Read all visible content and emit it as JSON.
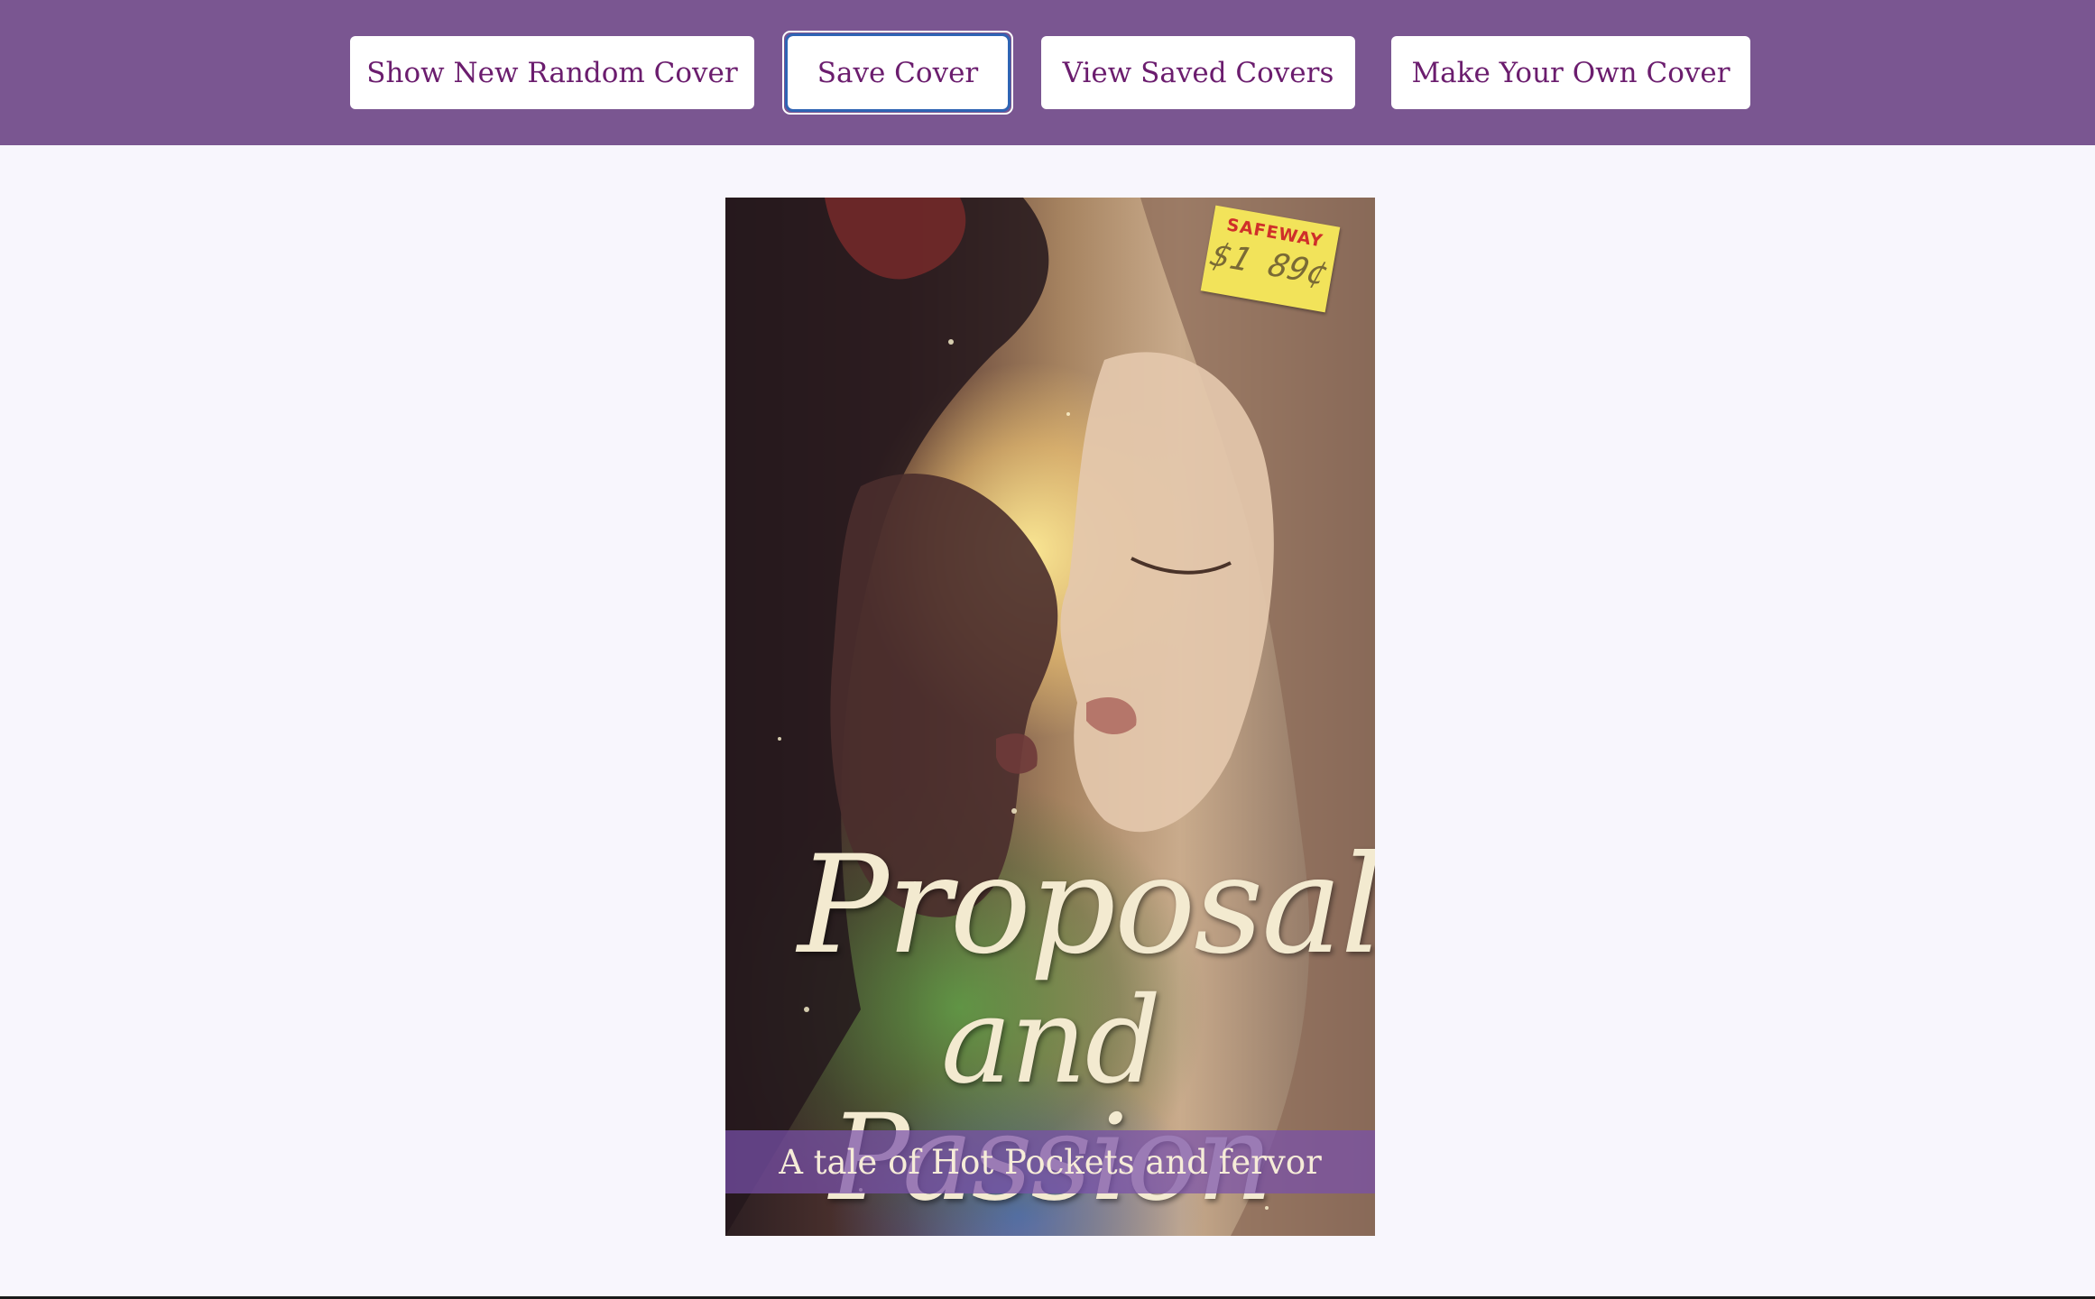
{
  "header": {
    "buttons": {
      "random": "Show New Random Cover",
      "save": "Save Cover",
      "view": "View Saved Covers",
      "make": "Make Your Own Cover"
    }
  },
  "cover": {
    "title_line1": "Proposals",
    "title_line2": "and Passion",
    "tagline": "A tale of Hot Pockets and fervor",
    "price_tag": {
      "store": "SAFEWAY",
      "price": "$1 89¢"
    }
  },
  "colors": {
    "header_bg": "#7a5691",
    "page_bg": "#f8f6fd",
    "button_text": "#6b1d6e",
    "focus_ring": "#2f64b4",
    "title_text": "#f3ead0"
  }
}
